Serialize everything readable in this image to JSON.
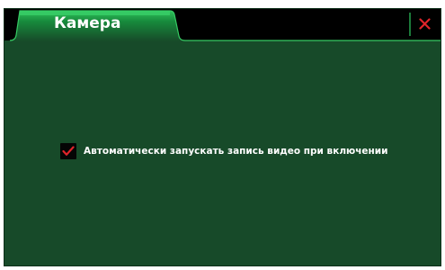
{
  "tab": {
    "label": "Камера"
  },
  "close_icon": "close-icon",
  "settings": {
    "auto_record_label": "Автоматически запускать запись видео при включении",
    "auto_record_checked": true
  },
  "colors": {
    "background": "#174a29",
    "topbar": "#000000",
    "tab_green": "#1a9a45",
    "close_red": "#e0242a",
    "check_red": "#e0242a"
  }
}
